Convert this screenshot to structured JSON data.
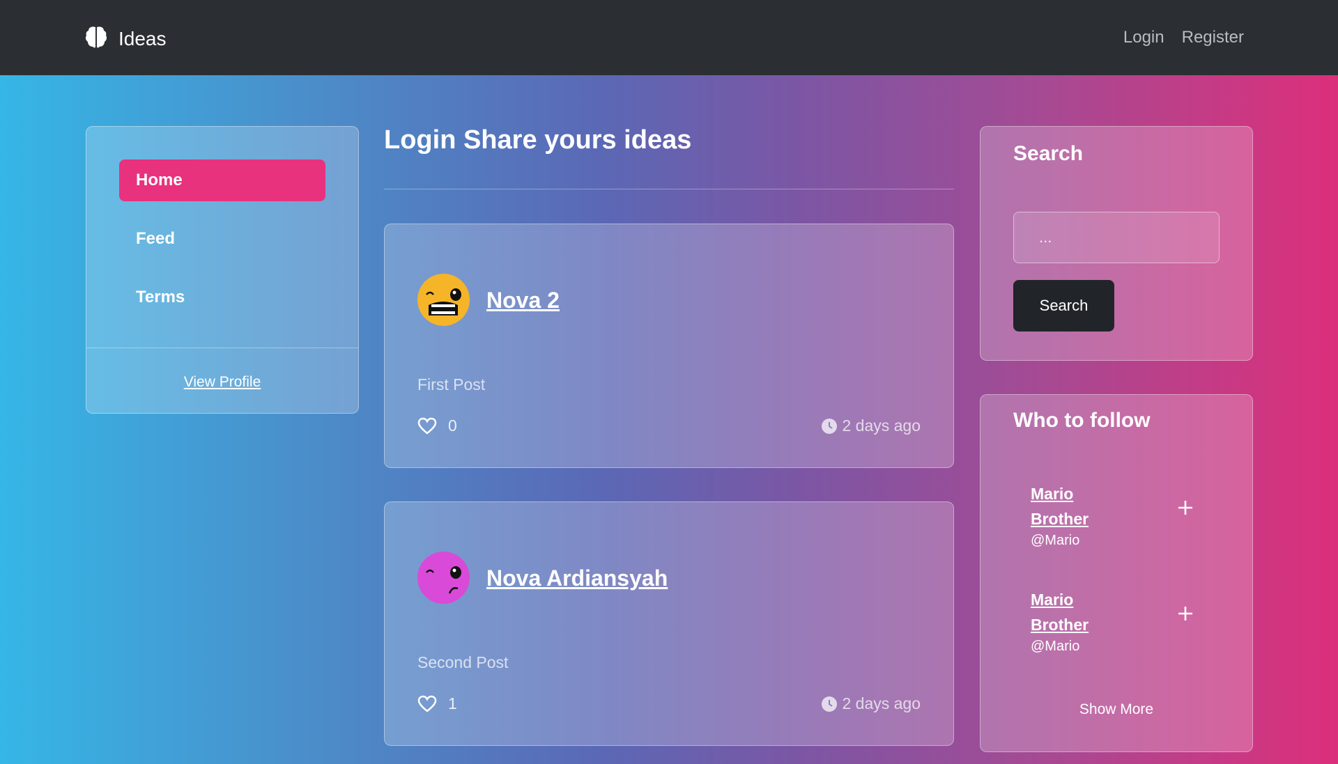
{
  "navbar": {
    "brand": "Ideas",
    "links": [
      "Login",
      "Register"
    ]
  },
  "sidebar": {
    "items": [
      {
        "label": "Home",
        "active": true
      },
      {
        "label": "Feed",
        "active": false
      },
      {
        "label": "Terms",
        "active": false
      }
    ],
    "view_profile": "View Profile"
  },
  "main": {
    "title": "Login Share yours ideas",
    "posts": [
      {
        "author": "Nova 2",
        "text": "First Post",
        "likes": "0",
        "time": "2 days ago",
        "avatar_color": "#f6b429"
      },
      {
        "author": "Nova Ardiansyah",
        "text": "Second Post",
        "likes": "1",
        "time": "2 days ago",
        "avatar_color": "#d94ad8"
      }
    ]
  },
  "search": {
    "title": "Search",
    "placeholder": "...",
    "button": "Search"
  },
  "who_to_follow": {
    "title": "Who to follow",
    "users": [
      {
        "name": "Mario Brother",
        "handle": "@Mario"
      },
      {
        "name": "Mario Brother",
        "handle": "@Mario"
      }
    ],
    "show_more": "Show More"
  },
  "colors": {
    "navbar": "#2b2f33",
    "accent": "#e8327d",
    "button_dark": "#212529"
  },
  "icons": [
    "brain-icon",
    "heart-icon",
    "clock-icon",
    "plus-icon"
  ]
}
